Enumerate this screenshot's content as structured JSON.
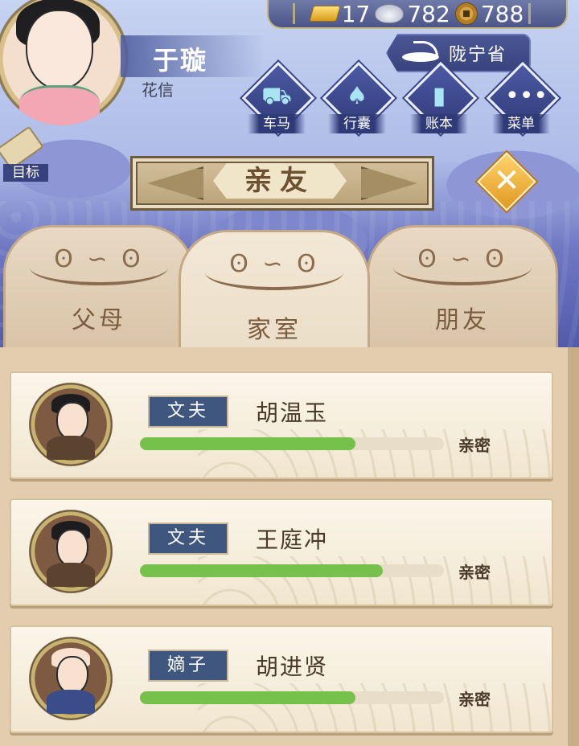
{
  "hud": {
    "gold": "17",
    "silver": "782",
    "copper": "788"
  },
  "player": {
    "name": "于璇",
    "title": "花信",
    "province": "陇宁省"
  },
  "nav": [
    {
      "label": "车马",
      "icon": "carriage-icon"
    },
    {
      "label": "行囊",
      "icon": "bag-icon"
    },
    {
      "label": "账本",
      "icon": "ledger-icon"
    },
    {
      "label": "菜单",
      "icon": "menu-icon"
    }
  ],
  "goal_label": "目标",
  "panel_title": "亲友",
  "tabs": [
    {
      "label": "父母",
      "active": false
    },
    {
      "label": "家室",
      "active": true
    },
    {
      "label": "朋友",
      "active": false
    }
  ],
  "relation_label": "亲密",
  "members": [
    {
      "role": "文夫",
      "name": "胡温玉",
      "intimacy": 0.71
    },
    {
      "role": "文夫",
      "name": "王庭冲",
      "intimacy": 0.8
    },
    {
      "role": "嫡子",
      "name": "胡进贤",
      "intimacy": 0.71
    }
  ],
  "colors": {
    "bar_fill": "#76c14b",
    "role_tag": "#3f567f",
    "close_button": "#e09a22"
  }
}
